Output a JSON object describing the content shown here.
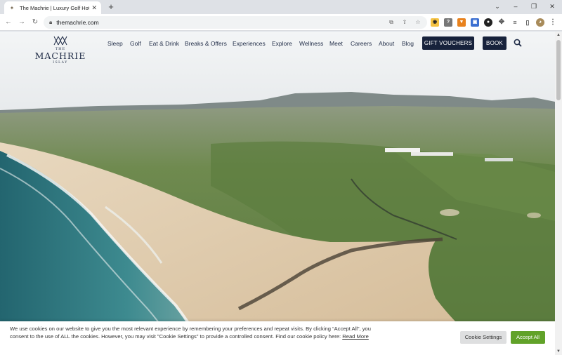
{
  "browser": {
    "tab_title": "The Machrie | Luxury Golf Hotel",
    "url": "themachrie.com",
    "new_tab_glyph": "+",
    "tab_close_glyph": "✕"
  },
  "site": {
    "logo": {
      "the": "THE",
      "name": "MACHRIE",
      "place": "ISLAY"
    },
    "nav": [
      {
        "label": "Sleep"
      },
      {
        "label": "Golf"
      },
      {
        "label": "Eat & Drink"
      },
      {
        "label": "Breaks & Offers"
      },
      {
        "label": "Experiences"
      },
      {
        "label": "Explore"
      },
      {
        "label": "Wellness"
      },
      {
        "label": "Meet"
      },
      {
        "label": "Careers"
      },
      {
        "label": "About"
      },
      {
        "label": "Blog"
      }
    ],
    "gift_vouchers_label": "GIFT VOUCHERS",
    "book_label": "BOOK"
  },
  "cookie": {
    "text": "We use cookies on our website to give you the most relevant experience by remembering your preferences and repeat visits. By clicking “Accept All”, you consent to the use of ALL the cookies. However, you may visit \"Cookie Settings\" to provide a controlled consent. Find our cookie policy here: ",
    "read_more": "Read More",
    "settings_label": "Cookie Settings",
    "accept_label": "Accept All"
  },
  "colors": {
    "navy": "#17223b",
    "accept_green": "#61a229"
  }
}
